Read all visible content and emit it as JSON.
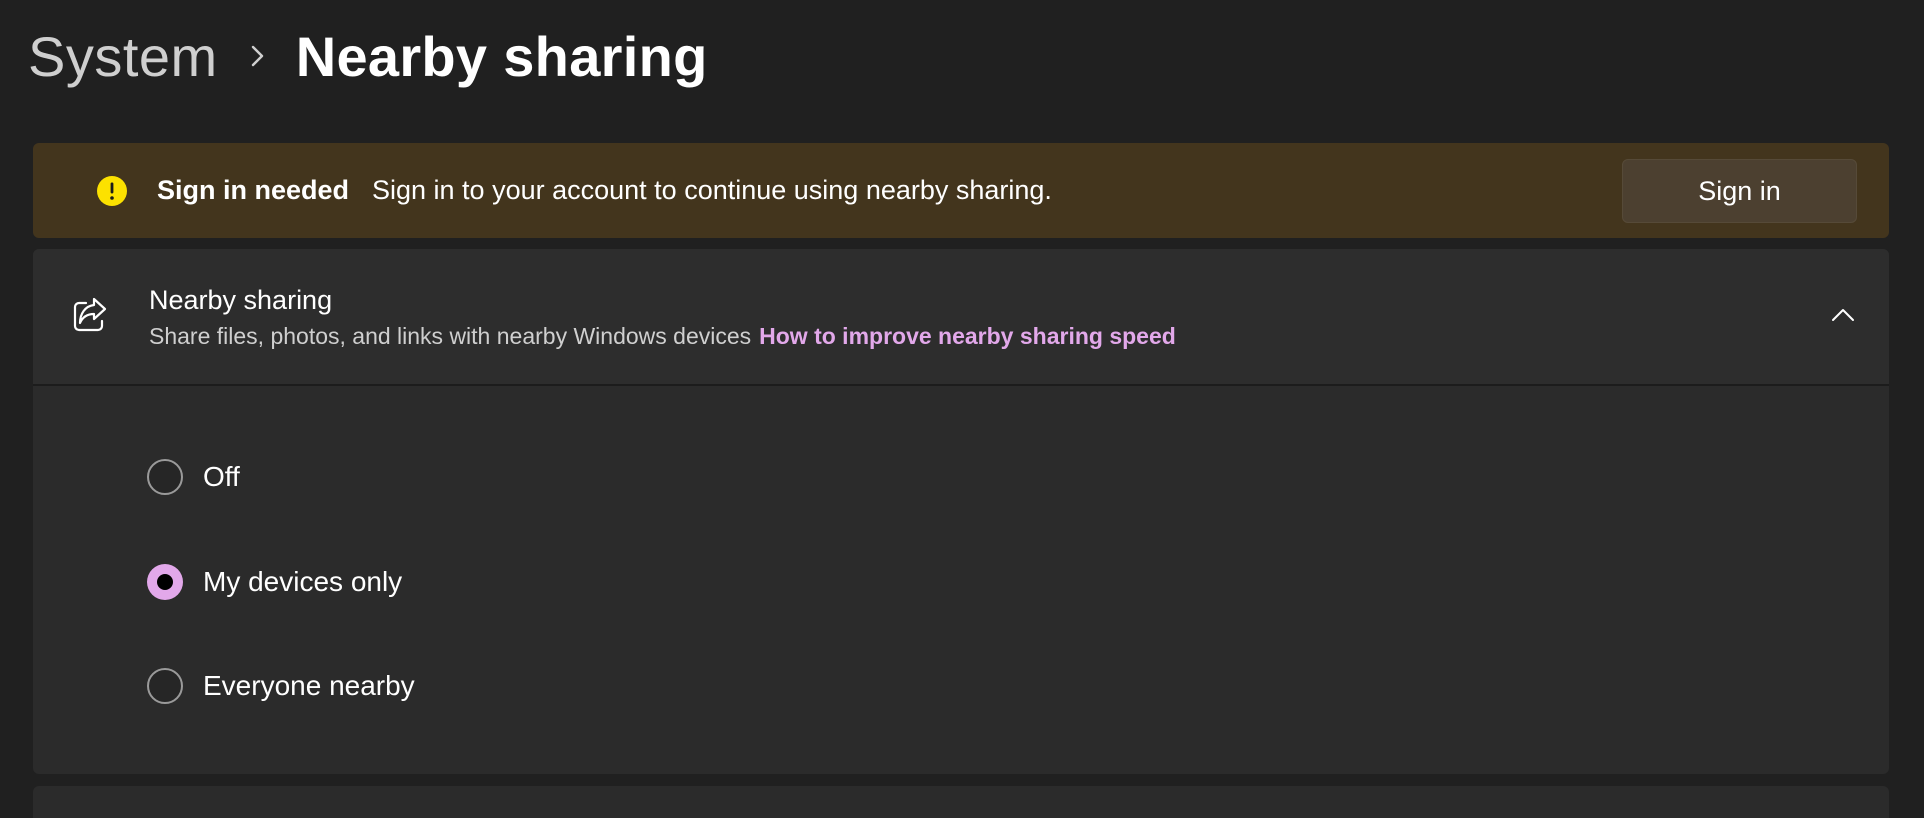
{
  "breadcrumb": {
    "parent": "System",
    "separator_icon": "chevron-right-icon",
    "current": "Nearby sharing"
  },
  "banner": {
    "icon": "warning-icon",
    "title": "Sign in needed",
    "message": "Sign in to your account to continue using nearby sharing.",
    "button_label": "Sign in",
    "background_color": "#43351d",
    "icon_color": "#fce100"
  },
  "nearby_card": {
    "icon": "share-icon",
    "title": "Nearby sharing",
    "description": "Share files, photos, and links with nearby Windows devices",
    "link_text": "How to improve nearby sharing speed",
    "link_color": "#e2a8ea",
    "expand_icon": "chevron-up-icon",
    "options": [
      {
        "label": "Off",
        "selected": false
      },
      {
        "label": "My devices only",
        "selected": true
      },
      {
        "label": "Everyone nearby",
        "selected": false
      }
    ],
    "selected_option": "My devices only"
  },
  "accent_color": "#e2a8ea"
}
